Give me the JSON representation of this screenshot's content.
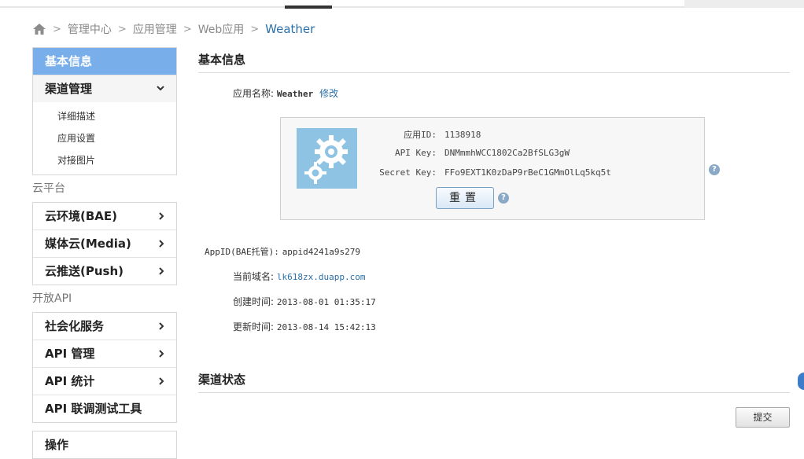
{
  "breadcrumb": {
    "items": [
      "管理中心",
      "应用管理",
      "Web应用"
    ],
    "current": "Weather"
  },
  "sidebar": {
    "active": "基本信息",
    "channel_mgmt": "渠道管理",
    "channel_sub": [
      "详细描述",
      "应用设置",
      "对接图片"
    ],
    "cloud_group": "云平台",
    "cloud_items": [
      "云环境(BAE)",
      "媒体云(Media)",
      "云推送(Push)"
    ],
    "api_group": "开放API",
    "api_items": [
      "社会化服务",
      "API 管理",
      "API 统计",
      "API 联调测试工具"
    ],
    "ops": "操作"
  },
  "main": {
    "basic_title": "基本信息",
    "app_name_label": "应用名称:",
    "app_name": "Weather",
    "edit_link": "修改",
    "app_id_label": "应用ID:",
    "app_id": "1138918",
    "api_key_label": "API Key:",
    "api_key": "DNMmmhWCC1802Ca2BfSLG3gW",
    "secret_key_label": "Secret Key:",
    "secret_key": "FFo9EXT1K0zDaP9rBeC1GMmOlLq5kq5t",
    "reset_label": "重置",
    "bae_label": "AppID(BAE托管):",
    "bae_value": "appid4241a9s279",
    "domain_label": "当前域名:",
    "domain_value": "lk618zx.duapp.com",
    "created_label": "创建时间:",
    "created_value": "2013-08-01 01:35:17",
    "updated_label": "更新时间:",
    "updated_value": "2013-08-14 15:42:13",
    "channel_status_title": "渠道状态",
    "submit_label": "提交"
  },
  "icons": {
    "home": "home-icon",
    "chevron_down": "chevron-down-icon",
    "chevron_right": "chevron-right-icon",
    "help": "help-icon",
    "gears": "gears-icon"
  },
  "colors": {
    "accent": "#78aeea",
    "link": "#2a6fa8",
    "app_icon_bg": "#8fc3e3"
  }
}
